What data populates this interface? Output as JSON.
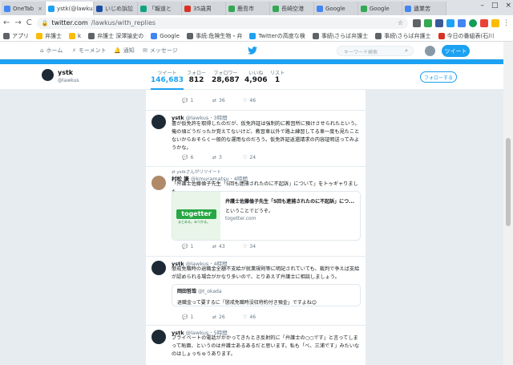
{
  "browser": {
    "tabs": [
      {
        "label": "OneTab",
        "color": "#4285f4"
      },
      {
        "label": "ystk(@lawkus)",
        "color": "#1da1f2",
        "active": true
      },
      {
        "label": "いじめ訴訟",
        "color": "#1a4ba3"
      },
      {
        "label": "「報道と",
        "color": "#10a37f"
      },
      {
        "label": "35歳男",
        "color": "#d93025"
      },
      {
        "label": "鹿島市",
        "color": "#34a853"
      },
      {
        "label": "長崎空港",
        "color": "#34a853"
      },
      {
        "label": "Google",
        "color": "#4285f4"
      },
      {
        "label": "Google",
        "color": "#34a853"
      },
      {
        "label": "遺業苦",
        "color": "#4285f4"
      }
    ],
    "tab_close": "×",
    "window_controls": [
      "–",
      "□",
      "×"
    ],
    "nav": {
      "back": "←",
      "forward": "→",
      "reload": "C"
    },
    "url_host": "twitter.com",
    "url_path": "/lawkus/with_replies",
    "bookmarks": [
      {
        "label": "アプリ",
        "color": "#5f6368"
      },
      {
        "label": "弁護士",
        "color": "#fbbc04"
      },
      {
        "label": "k",
        "color": "#fbbc04"
      },
      {
        "label": "弁護士 深澤諭史の",
        "color": "#5f6368"
      },
      {
        "label": "Google",
        "color": "#4285f4"
      },
      {
        "label": "事続:危険生物・弁",
        "color": "#5f6368"
      },
      {
        "label": "Twitterの高度な検",
        "color": "#1da1f2"
      },
      {
        "label": "事続\\さらば弁護士",
        "color": "#5f6368"
      },
      {
        "label": "事続\\さらば弁護士",
        "color": "#5f6368"
      },
      {
        "label": "今日の番組表(石川",
        "color": "#d93025"
      }
    ]
  },
  "topnav": {
    "home": "ホーム",
    "moments": "モーメント",
    "notifications": "通知",
    "messages": "メッセージ",
    "search_placeholder": "キーワード検索",
    "tweet_button": "ツイート"
  },
  "profile": {
    "name": "ystk",
    "handle": "@lawkus",
    "stats": [
      {
        "label": "ツイート",
        "value": "146,683"
      },
      {
        "label": "フォロー",
        "value": "812"
      },
      {
        "label": "フォロワー",
        "value": "28,687"
      },
      {
        "label": "いいね",
        "value": "4,906"
      },
      {
        "label": "リスト",
        "value": "1"
      }
    ],
    "follow_button": "フォローする"
  },
  "tweets": [
    {
      "replies": "1",
      "retweets": "36",
      "likes": "46"
    },
    {
      "name": "ystk",
      "handle": "@lawkus",
      "time": "3時間",
      "text": "書が仮免許を取得したのだが、仮免許証は強制的に教習所に預けさせられたという。俺の頃どうだったか覚えてないけど、教習車以外で路上練習してる車一度も見たことないからおそらく一般的な運用なのだろう。仮免許証返還請求の内容証明送ってみようかな。",
      "replies": "6",
      "retweets": "3",
      "likes": "24"
    },
    {
      "retweeted_by": "ystkさんがリツイート",
      "name": "村松 謙",
      "handle": "@kmuramatsu",
      "time": "4時間",
      "text": "「弁護士佐藤倫子先生「5回も逮捕されたのに不起訴」について」をトゥギャりました。",
      "card_title": "弁護士佐藤倫子先生「5回も逮捕されたのに不起訴」につ...",
      "card_desc": "ということでどうぞ。",
      "card_url": "togetter.com",
      "card_logo": "togetter",
      "card_logo_sub": "まとめる。みつかる。",
      "replies": "1",
      "retweets": "43",
      "likes": "34"
    },
    {
      "name": "ystk",
      "handle": "@lawkus",
      "time": "4時間",
      "text": "懲戒免職時の退職金全額不支給が就業規則等に明記されていても、裁判で争えば支給が認められる場合がかなり多いので、とりあえず弁護士に相談しましょう。",
      "quote_name": "岡田哲哉",
      "quote_handle": "@t_okada",
      "quote_text": "退職金って要するに「懲戒免職時没収特約付き預金」ですよね😊",
      "replies": "1",
      "retweets": "26",
      "likes": "46"
    },
    {
      "name": "ystk",
      "handle": "@lawkus",
      "time": "5時間",
      "text": "プライベートの電話がかかってきたとき反射的に「弁護士の○○です」と言ってしまって恥面、というのは弁護士あるあるだと思います。私も「べ、三浦です」みたいなのはしょっちゅうあります。"
    }
  ],
  "icons": {
    "reply": "💬",
    "retweet": "⇄",
    "like": "♡",
    "more": "⋯",
    "search": "🔍"
  },
  "colors": {
    "accent": "#1da1f2",
    "background": "#e6ecf0"
  }
}
